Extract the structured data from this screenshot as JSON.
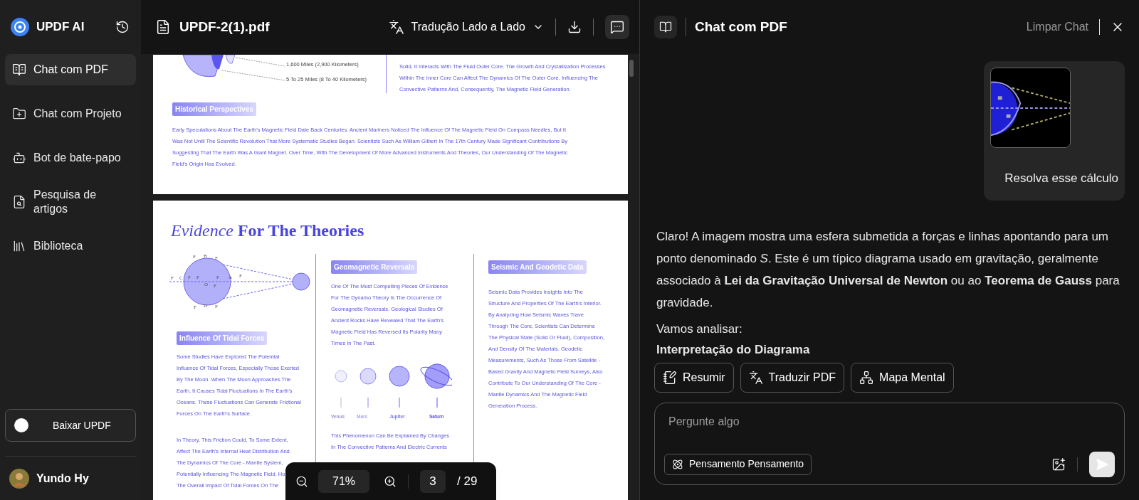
{
  "sidebar": {
    "app_name": "UPDF AI",
    "items": [
      {
        "label": "Chat com PDF",
        "selected": true,
        "kind": "pdf"
      },
      {
        "label": "Chat com Projeto",
        "selected": false,
        "kind": "project"
      },
      {
        "label": "Bot de bate-papo",
        "selected": false,
        "kind": "bot"
      },
      {
        "label": "Pesquisa de artigos",
        "selected": false,
        "kind": "research"
      },
      {
        "label": "Biblioteca",
        "selected": false,
        "kind": "library"
      }
    ],
    "download_button": "Baixar UPDF",
    "user": {
      "name": "Yundo Hy"
    }
  },
  "document": {
    "file_name": "UPDF-2(1).pdf",
    "translate_mode": "Tradução Lado a Lado",
    "page_top": {
      "diagram_labels": [
        "1,600 Miles (2,900 Kilometers)",
        "5 To 25 Miles (8 To 40 Kilometers)"
      ],
      "column_lines": [
        "Solid, It Interacts With The Fluid Outer Core. The Growth And Crystallization Processes",
        "Within The Inner Core Can Affect The Dynamics Of The Outer Core, Influencing The",
        "Convective Patterns And, Consequently, The Magnetic Field Generation."
      ],
      "section": {
        "heading": "Historical Perspectives",
        "lines": [
          "Early Speculations About The Earth's Magnetic Field Date Back Centuries. Ancient Mariners Noticed The Influence Of The Magnetic Field On Compass Needles, But It",
          "Was Not Until The Scientific Revolution That More Systematic Studies Began. Scientists Such As William Gilbert In The 17th Century Made Significant Contributions By",
          "Suggesting That The Earth Was A Giant Magnet. Over Time, With The Development Of More Advanced Instruments And Theories, Our Understanding Of The Magnetic",
          "Field's Origin Has Evolved."
        ]
      }
    },
    "page": {
      "title": "*Evidence* **For The Theories**",
      "force_labels": [
        "F",
        "B",
        "F",
        "F",
        "C",
        "F",
        "F",
        "F",
        "A",
        "F",
        "O",
        "F",
        "F",
        "D",
        "F"
      ],
      "left": {
        "heading": "Influence Of Tidal Forces",
        "paragraphs": [
          [
            "Some Studies Have Explored The Potential",
            "Influence Of Tidal Forces, Especially Those Exerted",
            "By The Moon. When The Moon Approaches The",
            "Earth, It Causes Tidal Fluctuations In The Earth's",
            "Oceans. These Fluctuations Can Generate Frictional",
            "Forces On The Earth's Surface."
          ],
          [
            "In Theory, This Friction Could, To Some Extent,",
            "Affect The Earth's Internal Heat Distribution And",
            "The Dynamics Of The Core - Mantle System,",
            "Potentially Influencing The Magnetic Field. Ho",
            "The Overall Impact Of Tidal Forces On The"
          ]
        ]
      },
      "middle": {
        "heading": "Geomagnetic Reversals",
        "lines": [
          "One Of The Most Compelling Pieces Of Evidence",
          "For The Dynamo Theory Is The Occurrence Of",
          "Geomagnetic Reversals. Geological Studies Of",
          "Ancient Rocks Have Revealed That The Earth's",
          "Magnetic Field Has Reversed Its Polarity Many",
          "Times In The Past."
        ],
        "planets": [
          "Venus",
          "Mars",
          "Jupiter",
          "Saturn"
        ],
        "after_lines": [
          "This Phenomenon Can Be Explained By Changes",
          "In The Convective Patterns And Electric Currents"
        ]
      },
      "right": {
        "heading": "Seismic And Geodetic Data",
        "lines": [
          "Seismic Data Provides Insights Into The",
          "Structure And Properties Of The Earth's Interior.",
          "By Analyzing How Seismic Waves Trave",
          "Through The Core, Scientists Can Determine",
          "The Physical State (Solid Or Fluid), Composition,",
          "And Density Of The Materials. Geodetic",
          "Measurements, Such As Those From Satellite -",
          "Based Gravity And Magnetic Field Surveys, Also",
          "Contribute To Our Understanding Of The Core -",
          "Mantle Dynamics And The Magnetic Field",
          "Generation Process."
        ]
      }
    },
    "zoom": "71%",
    "page_number": "3",
    "page_total": "/ 29"
  },
  "chat": {
    "title": "Chat com PDF",
    "clear": "Limpar Chat",
    "user_message": {
      "text": "Resolva esse cálculo"
    },
    "answer": {
      "paragraph": "Claro! A imagem mostra uma esfera submetida a forças e linhas apontando para um ponto denominado *S*. Este é um típico diagrama usado em gravitação, geralmente associado à **Lei da Gravitação Universal de Newton** ou ao **Teorema de Gauss** para gravidade.",
      "intro": "Vamos analisar:",
      "heading": "Interpretação do Diagrama"
    },
    "actions": [
      {
        "label": "Resumir",
        "kind": "summary"
      },
      {
        "label": "Traduzir PDF",
        "kind": "translate"
      },
      {
        "label": "Mapa Mental",
        "kind": "mindmap"
      }
    ],
    "input": {
      "placeholder": "Pergunte algo",
      "mode": "Pensamento Pensamento"
    }
  }
}
